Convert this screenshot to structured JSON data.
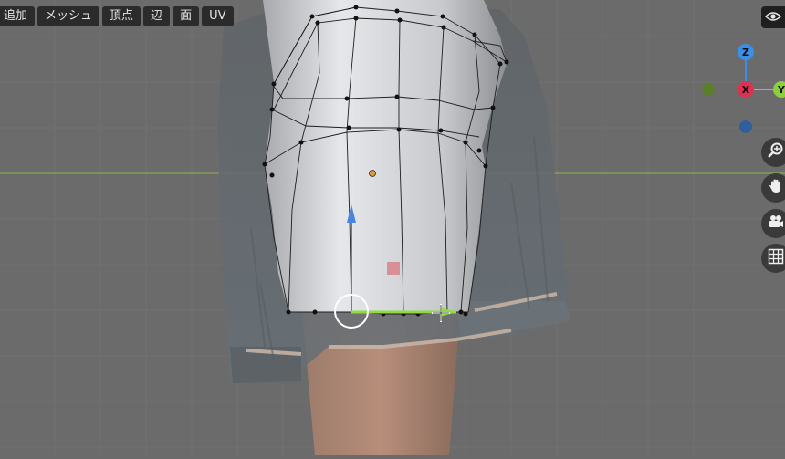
{
  "header_menu": {
    "items": [
      "追加",
      "メッシュ",
      "頂点",
      "辺",
      "面",
      "UV"
    ]
  },
  "gizmo": {
    "z_label": "Z",
    "x_label": "X",
    "y_label": "Y",
    "colors": {
      "x": "#e0304f",
      "y": "#8bcf3d",
      "z": "#3c8fe6"
    }
  },
  "nav_icons": [
    "zoom-icon",
    "hand-pan-icon",
    "camera-icon",
    "grid-icon"
  ],
  "theme": {
    "viewport_bg": "#6b6b6b",
    "header_button_bg": "#2b2b2b",
    "x_axis_line": "#8fb34f"
  }
}
